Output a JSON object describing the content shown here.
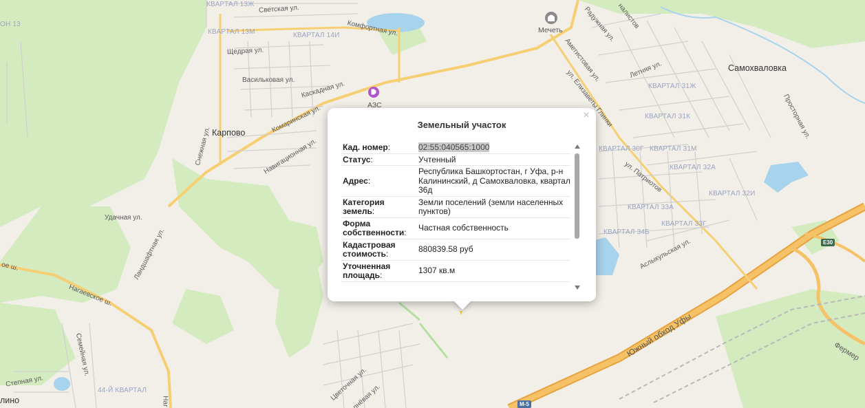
{
  "map": {
    "labels": {
      "kvartal_13zh": "КВАРТАЛ 13Ж",
      "svetskaya": "Светская ул.",
      "kvartal_13m": "КВАРТАЛ 13М",
      "kvartal_14i": "КВАРТАЛ 14И",
      "komfortnaya": "Комфортная ул.",
      "shchedraya": "Щедрая ул.",
      "vasilkovaya": "Васильковая ул.",
      "kaskadnaya": "Каскадная ул.",
      "komarinskaya": "Комаринская ул.",
      "snezhnaya": "Снежная ул.",
      "karpovo": "Карпово",
      "navigatsionnaya": "Навигационная ул.",
      "udachnaya": "Удачная ул.",
      "landshaftnaya": "Ландшафтная ул.",
      "nagaevskoe1": "Нагаевское ш.",
      "nagaevskoe2": "ое ш.",
      "semeynaya": "Семейная ул.",
      "stepnaya": "Степная ул.",
      "kvartal_44": "44-Й КВАРТАЛ",
      "lino": "лино",
      "tsvetochnaya": "Цветочная ул.",
      "lineynaya": "лнёвая ул.",
      "on13": "ОН 13",
      "azs": "АЗС",
      "mechet": "Мечеть",
      "raduzhnaya": "Радужная ул.",
      "ametistovaya": "Аметистовая ул.",
      "elizaveta": "ул. Елизаветы Глинки",
      "letnyaya": "Летняя ул.",
      "kvartal_31zh": "КВАРТАЛ 31Ж",
      "kvartal_31k": "КВАРТАЛ 31К",
      "kvartal_30g": "КВАРТАЛ 30Г",
      "kvartal_31m": "КВАРТАЛ 31М",
      "kvartal_32a": "КВАРТАЛ 32А",
      "kvartal_32i": "КВАРТАЛ 32И",
      "kvartal_33a": "КВАРТАЛ 33А",
      "kvartal_33g": "КВАРТАЛ 33Г",
      "kvartal_34b": "КВАРТАЛ 34Б",
      "patriotov": "ул. Патриотов",
      "aslykulskaya": "Аслыкульская ул.",
      "samokhvalovka": "Самохваловка",
      "prostornaya": "Просторная ул.",
      "yuzhny_obkhod": "Южный обход Уфы",
      "fermer": "Фермер",
      "nalistov": "налистов",
      "e30": "E30",
      "m5": "М-5",
      "nag": "Наг"
    },
    "colors": {
      "land": "#f2efe9",
      "forest": "#d4ebc0",
      "water": "#a8d3ec",
      "road_major": "#f8d478",
      "highway": "#f0b24a",
      "minor_road": "#c9c9c9"
    }
  },
  "popup": {
    "title": "Земельный участок",
    "close": "×",
    "rows": [
      {
        "key": "Кад. номер",
        "value": "02:55:040565:1000"
      },
      {
        "key": "Статус",
        "value": "Учтенный"
      },
      {
        "key": "Адрес",
        "value": "Республика Башкортостан, г Уфа, р-н Калининский, д Самохваловка, квартал 36д"
      },
      {
        "key": "Категория земель",
        "value": "Земли поселений (земли населенных пунктов)"
      },
      {
        "key": "Форма собственности",
        "value": "Частная собственность"
      },
      {
        "key": "Кадастровая стоимость",
        "value": "880839.58 руб"
      },
      {
        "key": "Уточненная площадь",
        "value": "1307 кв.м"
      }
    ],
    "colon": ":"
  }
}
